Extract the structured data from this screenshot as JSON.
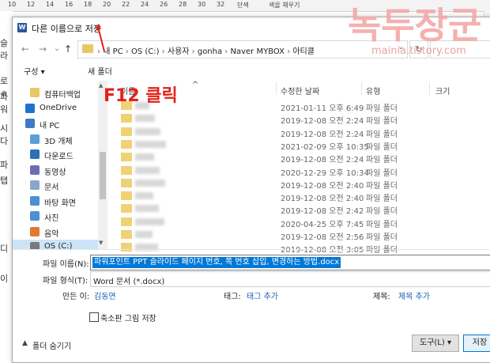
{
  "ruler": {
    "ticks": [
      "10",
      "12",
      "14",
      "16",
      "18",
      "20",
      "22",
      "24",
      "26",
      "28",
      "30",
      "32"
    ],
    "mid_text": "단색",
    "right_text": "색을 채우기"
  },
  "background_doc": {
    "left_fragments": [
      "슬라",
      "로 ㅎ",
      "파워",
      "시다",
      "파",
      "탭",
      "",
      "디",
      "이"
    ]
  },
  "dialog": {
    "title": "다른 이름으로 저장",
    "nav": {
      "back": "←",
      "forward": "→",
      "down": "⌄",
      "up": "↑",
      "refresh": "↻"
    },
    "address": [
      "내 PC",
      "OS (C:)",
      "사용자",
      "gonha",
      "Naver MYBOX",
      "아티클"
    ],
    "address_sep": "›",
    "toolbar": {
      "organize": "구성 ▾",
      "new_folder": "새 폴더"
    },
    "sidebar": [
      {
        "label": "컴퓨터백업",
        "color": "#e8c766"
      },
      {
        "label": "OneDrive",
        "color": "#1e73d0"
      },
      {
        "label": "내 PC",
        "color": "#3f7bc4"
      },
      {
        "label": "3D 개체",
        "color": "#5aa0d8"
      },
      {
        "label": "다운로드",
        "color": "#2c6fbb"
      },
      {
        "label": "동영상",
        "color": "#6a6fb4"
      },
      {
        "label": "문서",
        "color": "#8aa7c9"
      },
      {
        "label": "바탕 화면",
        "color": "#4d8fd1"
      },
      {
        "label": "사진",
        "color": "#4d8fd1"
      },
      {
        "label": "음악",
        "color": "#e07a2f"
      },
      {
        "label": "OS (C:)",
        "color": "#7a7a7a"
      }
    ],
    "columns": {
      "name": "이름",
      "date": "수정한 날짜",
      "type": "유형",
      "size": "크기"
    },
    "rows": [
      {
        "date": "2021-01-11 오후 6:49",
        "type": "파일 폴더"
      },
      {
        "date": "2019-12-08 오전 2:24",
        "type": "파일 폴더"
      },
      {
        "date": "2019-12-08 오전 2:24",
        "type": "파일 폴더"
      },
      {
        "date": "2021-02-09 오후 10:35",
        "type": "파일 폴더"
      },
      {
        "date": "2019-12-08 오전 2:24",
        "type": "파일 폴더"
      },
      {
        "date": "2020-12-29 오후 10:34",
        "type": "파일 폴더"
      },
      {
        "date": "2019-12-08 오전 2:40",
        "type": "파일 폴더"
      },
      {
        "date": "2019-12-08 오전 2:40",
        "type": "파일 폴더"
      },
      {
        "date": "2019-12-08 오전 2:42",
        "type": "파일 폴더"
      },
      {
        "date": "2020-04-25 오후 7:45",
        "type": "파일 폴더"
      },
      {
        "date": "2019-12-08 오전 2:56",
        "type": "파일 폴더"
      },
      {
        "date": "2019-12-08 오전 3:05",
        "type": "파일 폴더"
      }
    ],
    "form": {
      "filename_label": "파일 이름(N):",
      "filename_value": "파워포인트 PPT 슬라이드 페이지 번호, 쪽 번호 삽입, 변경하는 방법.docx",
      "filetype_label": "파일 형식(T):",
      "filetype_value": "Word 문서 (*.docx)",
      "author_label": "만든 이:",
      "author_value": "김동연",
      "tags_label": "태그:",
      "tags_value": "태그 추가",
      "title_label": "제목:",
      "title_value": "제목 추가",
      "thumbnail_label": "축소판 그림 저장",
      "hide_folders": "폴더 숨기기",
      "tools": "도구(L)",
      "save": "저장"
    }
  },
  "annotation": {
    "text": "F12 클릭",
    "color": "#e3201b"
  },
  "watermark": {
    "big": "녹두장군",
    "url": "mainia.tistory.com"
  }
}
